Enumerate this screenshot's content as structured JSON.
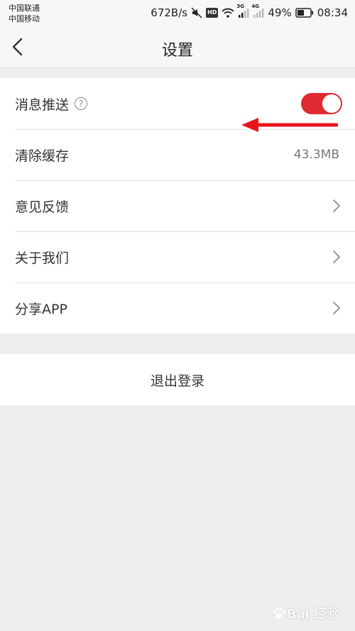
{
  "status_bar": {
    "carrier_1": "中国联通",
    "carrier_2": "中国移动",
    "speed": "672B/s",
    "hd": "HD",
    "net_3g": "3G",
    "net_4g": "4G",
    "battery": "49%",
    "time": "08:34",
    "icons": [
      "mute-icon",
      "wifi-icon",
      "signal-icon",
      "battery-icon"
    ]
  },
  "navbar": {
    "title": "设置"
  },
  "settings": {
    "items": [
      {
        "label": "消息推送",
        "help": "?",
        "control": "toggle",
        "enabled": true
      },
      {
        "label": "清除缓存",
        "value": "43.3MB"
      },
      {
        "label": "意见反馈",
        "control": "chevron"
      },
      {
        "label": "关于我们",
        "control": "chevron"
      },
      {
        "label": "分享APP",
        "control": "chevron"
      }
    ]
  },
  "logout": {
    "label": "退出登录"
  },
  "colors": {
    "accent": "#e02a32",
    "background": "#eeeeee",
    "annotation": "#e8141c"
  },
  "watermark": {
    "text": "Bai 经验"
  }
}
